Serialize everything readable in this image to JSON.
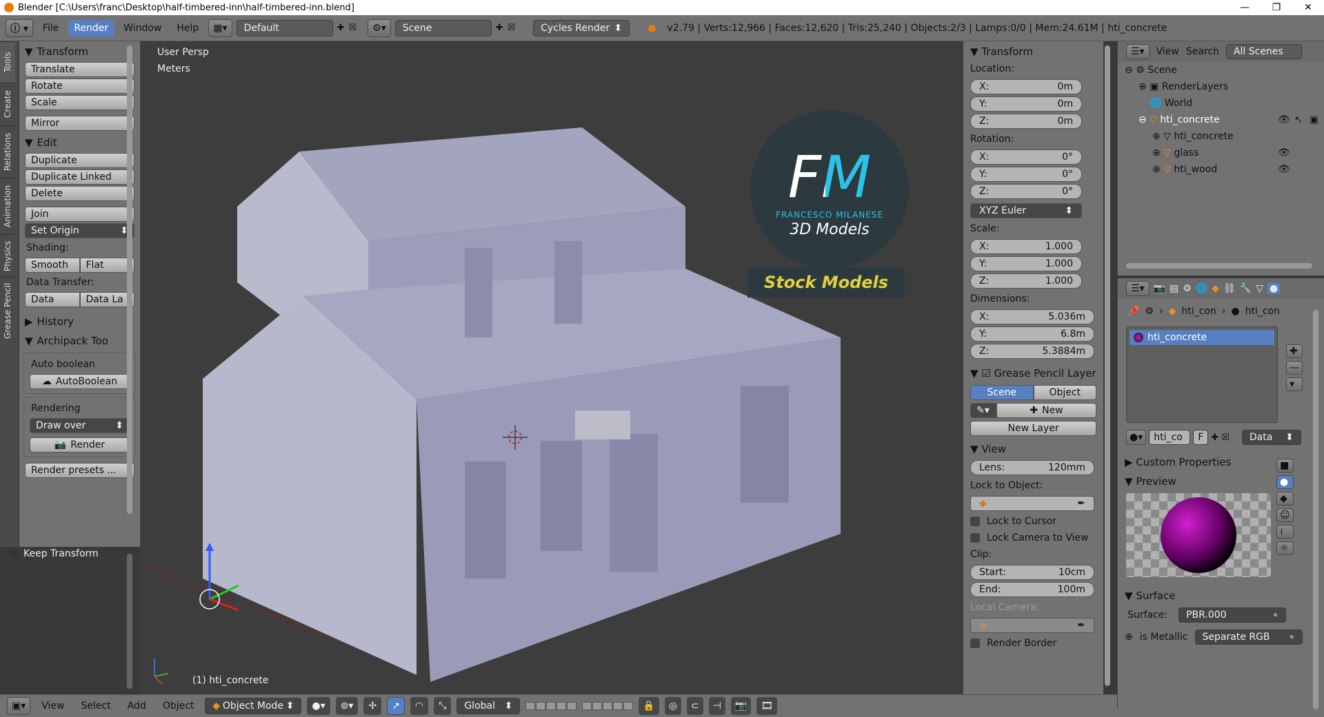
{
  "window": {
    "title": "Blender  [C:\\Users\\franc\\Desktop\\half-timbered-inn\\half-timbered-inn.blend]"
  },
  "top_menu": [
    "File",
    "Render",
    "Window",
    "Help"
  ],
  "layout": "Default",
  "scene": "Scene",
  "engine": "Cycles Render",
  "stats": "v2.79 | Verts:12,966 | Faces:12,620 | Tris:25,240 | Objects:2/3 | Lamps:0/0 | Mem:24.61M | hti_concrete",
  "left_tabs": [
    "Tools",
    "Create",
    "Relations",
    "Animation",
    "Physics",
    "Grease Pencil"
  ],
  "toolshelf": {
    "transform": "Transform",
    "translate": "Translate",
    "rotate": "Rotate",
    "scale": "Scale",
    "mirror": "Mirror",
    "edit": "Edit",
    "duplicate": "Duplicate",
    "duplicate_linked": "Duplicate Linked",
    "delete": "Delete",
    "join": "Join",
    "set_origin": "Set Origin",
    "shading_label": "Shading:",
    "smooth": "Smooth",
    "flat": "Flat",
    "data_transfer_label": "Data Transfer:",
    "data": "Data",
    "data_la": "Data La",
    "history": "History",
    "archipack": "Archipack Too",
    "auto_boolean_label": "Auto boolean",
    "autoboolean_btn": "AutoBoolean",
    "rendering_label": "Rendering",
    "draw_over": "Draw over",
    "render_btn": "Render",
    "render_presets": "Render presets ...",
    "keep_transform": "Keep Transform"
  },
  "viewport": {
    "view_name": "User Persp",
    "units": "Meters",
    "object_label": "(1) hti_concrete",
    "logo_letters": "FM",
    "logo_name": "FRANCESCO MILANESE",
    "logo_sub": "3D Models",
    "logo_stock": "Stock Models"
  },
  "npanel": {
    "transform": "Transform",
    "location_label": "Location:",
    "loc": [
      {
        "k": "X:",
        "v": "0m"
      },
      {
        "k": "Y:",
        "v": "0m"
      },
      {
        "k": "Z:",
        "v": "0m"
      }
    ],
    "rotation_label": "Rotation:",
    "rot": [
      {
        "k": "X:",
        "v": "0°"
      },
      {
        "k": "Y:",
        "v": "0°"
      },
      {
        "k": "Z:",
        "v": "0°"
      }
    ],
    "rotation_mode": "XYZ Euler",
    "scale_label": "Scale:",
    "scale": [
      {
        "k": "X:",
        "v": "1.000"
      },
      {
        "k": "Y:",
        "v": "1.000"
      },
      {
        "k": "Z:",
        "v": "1.000"
      }
    ],
    "dimensions_label": "Dimensions:",
    "dim": [
      {
        "k": "X:",
        "v": "5.036m"
      },
      {
        "k": "Y:",
        "v": "6.8m"
      },
      {
        "k": "Z:",
        "v": "5.3884m"
      }
    ],
    "grease_pencil": "Grease Pencil Layer",
    "gp_scene": "Scene",
    "gp_object": "Object",
    "gp_new": "New",
    "gp_new_layer": "New Layer",
    "view": "View",
    "lens_k": "Lens:",
    "lens_v": "120mm",
    "lock_object": "Lock to Object:",
    "lock_cursor": "Lock to Cursor",
    "lock_camera": "Lock Camera to View",
    "clip_label": "Clip:",
    "clip_start_k": "Start:",
    "clip_start_v": "10cm",
    "clip_end_k": "End:",
    "clip_end_v": "100m",
    "local_camera": "Local Camera:",
    "render_border": "Render Border"
  },
  "outliner": {
    "view": "View",
    "search": "Search",
    "filter": "All Scenes",
    "items": [
      "Scene",
      "RenderLayers",
      "World",
      "hti_concrete",
      "hti_concrete",
      "glass",
      "hti_wood"
    ]
  },
  "properties": {
    "breadcrumb_1": "hti_con",
    "breadcrumb_2": "hti_con",
    "material_slot": "hti_concrete",
    "mat_name": "hti_co",
    "mat_f": "F",
    "data_dropdown": "Data",
    "custom_props": "Custom Properties",
    "preview": "Preview",
    "surface_section": "Surface",
    "surface_label": "Surface:",
    "surface_value": "PBR.000",
    "is_metallic_label": "is Metallic",
    "is_metallic_value": "Separate RGB"
  },
  "bottom_bar": {
    "view": "View",
    "select": "Select",
    "add": "Add",
    "object": "Object",
    "mode": "Object Mode",
    "orientation": "Global"
  },
  "colors": {
    "accent": "#5680c2",
    "panel": "#727272",
    "viewport": "#3d3d3d",
    "mesh": "#a5a6c0"
  }
}
